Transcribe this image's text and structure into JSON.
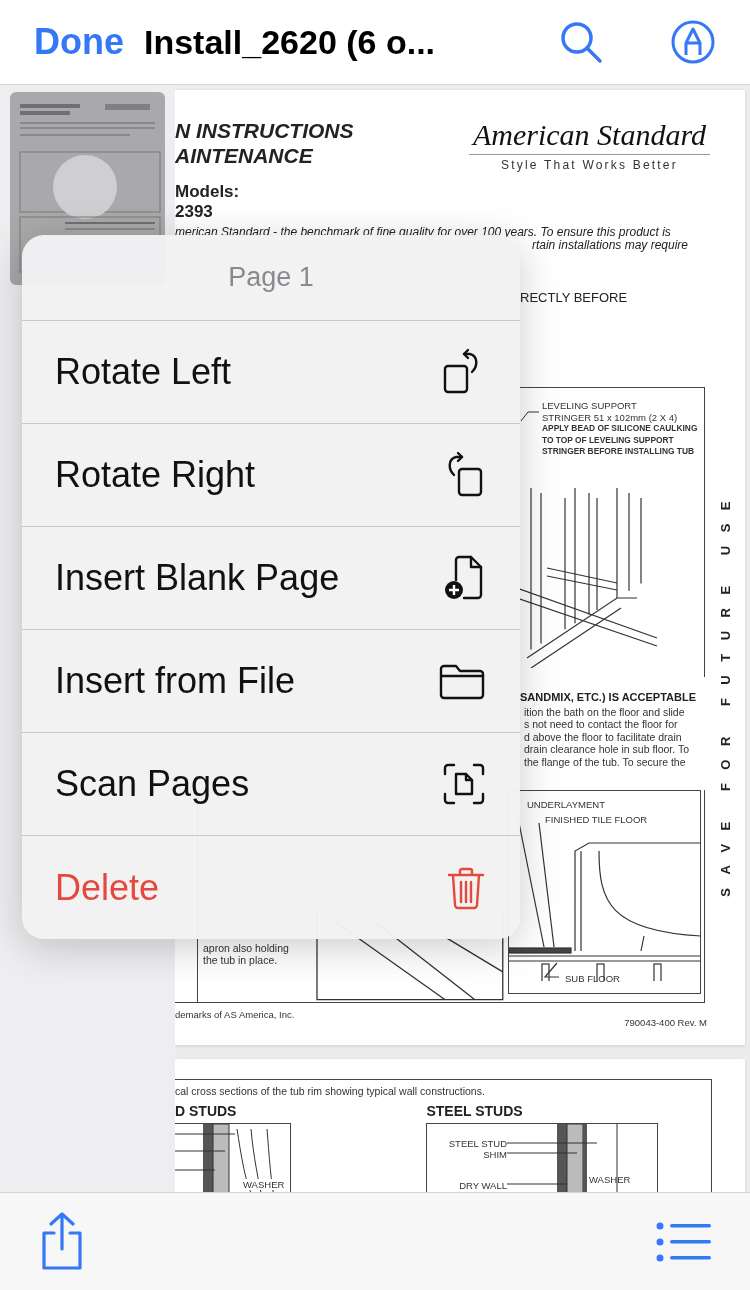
{
  "nav": {
    "done": "Done",
    "title": "Install_2620 (6 o..."
  },
  "page_1": {
    "title_lines": [
      "N INSTRUCTIONS",
      "AINTENANCE"
    ],
    "logo": "American Standard",
    "tagline": "Style That Works Better",
    "models_label": "Models:",
    "model_number": "2393",
    "intro_lines": [
      "merican Standard - the benchmark of fine quality for over 100 years. To ensure this product is",
      "rtain installations may require"
    ],
    "step_fragment": "RECTLY BEFORE",
    "figure_1_labels": [
      "LEVELING SUPPORT",
      "STRINGER 51 x 102mm (2 X 4)"
    ],
    "figure_1_note": [
      "APPLY BEAD OF SILICONE CAULKING",
      "TO TOP OF LEVELING SUPPORT",
      "STRINGER BEFORE INSTALLING TUB"
    ],
    "side_note": "SAVE FOR FUTURE USE",
    "section_heading": "SANDMIX, ETC.)  IS ACCEPTABLE",
    "section_lines": [
      "ition the bath on the floor and slide",
      "s not need to contact the floor for",
      "d above the floor to facilitate drain",
      "drain clearance hole in sub floor. To",
      "the flange of the tub. To secure the"
    ],
    "figure_2_labels": {
      "underlayment": "UNDERLAYMENT",
      "tile": "FINISHED TILE FLOOR",
      "sub_floor": "SUB FLOOR"
    },
    "apron_lines": [
      "apron also holding",
      "the tub in place."
    ],
    "trademark": "demarks of AS America, Inc.",
    "doc_number": "790043-400 Rev. M"
  },
  "page_2": {
    "caption": "cal cross sections of the tub rim showing typical wall constructions.",
    "wood_heading": "D STUDS",
    "steel_heading": "STEEL STUDS",
    "wood_washer": "WASHER",
    "steel_labels": [
      "STEEL STUD",
      "SHIM",
      "DRY WALL"
    ],
    "steel_washer": "WASHER"
  },
  "menu": {
    "title": "Page 1",
    "items": [
      {
        "label": "Rotate Left",
        "kind": "rotate-left"
      },
      {
        "label": "Rotate Right",
        "kind": "rotate-right"
      },
      {
        "label": "Insert Blank Page",
        "kind": "insert-blank"
      },
      {
        "label": "Insert from File",
        "kind": "insert-file"
      },
      {
        "label": "Scan Pages",
        "kind": "scan"
      },
      {
        "label": "Delete",
        "kind": "delete"
      }
    ]
  }
}
